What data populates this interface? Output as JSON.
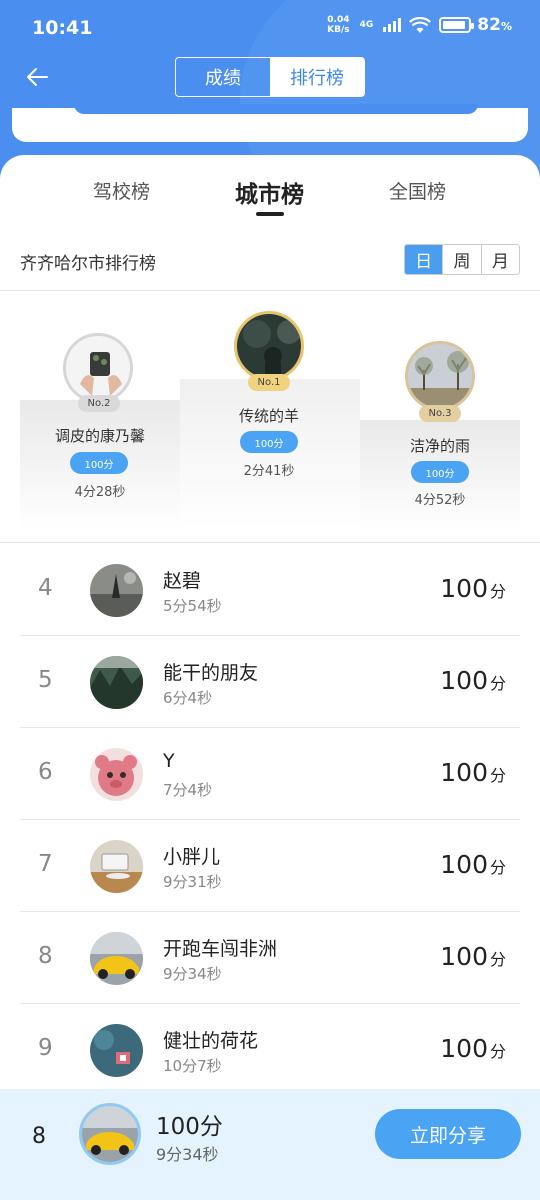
{
  "status_bar": {
    "time": "10:41",
    "net_speed_value": "0.04",
    "net_speed_unit": "KB/s",
    "network": "4G",
    "battery": "82",
    "battery_unit": "%"
  },
  "header": {
    "segments": [
      "成绩",
      "排行榜"
    ],
    "active_segment": "排行榜"
  },
  "tabs": {
    "items": [
      "驾校榜",
      "城市榜",
      "全国榜"
    ],
    "active": "城市榜"
  },
  "ranking": {
    "title": "齐齐哈尔市排行榜",
    "ranges": [
      "日",
      "周",
      "月"
    ],
    "active_range": "日"
  },
  "podium": {
    "first": {
      "tag": "No.1",
      "name": "传统的羊",
      "score": "100分",
      "time": "2分41秒"
    },
    "second": {
      "tag": "No.2",
      "name": "调皮的康乃馨",
      "score": "100分",
      "time": "4分28秒"
    },
    "third": {
      "tag": "No.3",
      "name": "洁净的雨",
      "score": "100分",
      "time": "4分52秒"
    }
  },
  "list": [
    {
      "rank": "4",
      "name": "赵碧",
      "time": "5分54秒",
      "score": "100",
      "unit": "分"
    },
    {
      "rank": "5",
      "name": "能干的朋友",
      "time": "6分4秒",
      "score": "100",
      "unit": "分"
    },
    {
      "rank": "6",
      "name": "Y",
      "time": "7分4秒",
      "score": "100",
      "unit": "分"
    },
    {
      "rank": "7",
      "name": "小胖儿",
      "time": "9分31秒",
      "score": "100",
      "unit": "分"
    },
    {
      "rank": "8",
      "name": "开跑车闯非洲",
      "time": "9分34秒",
      "score": "100",
      "unit": "分"
    },
    {
      "rank": "9",
      "name": "健壮的荷花",
      "time": "10分7秒",
      "score": "100",
      "unit": "分"
    }
  ],
  "my_rank": {
    "rank": "8",
    "score": "100分",
    "time": "9分34秒",
    "share_label": "立即分享"
  },
  "colors": {
    "primary": "#4a8ff0",
    "accent": "#4aa3f3",
    "gold": "#e7c36a",
    "silver": "#d6d6d6",
    "bronze": "#d8c49a"
  }
}
